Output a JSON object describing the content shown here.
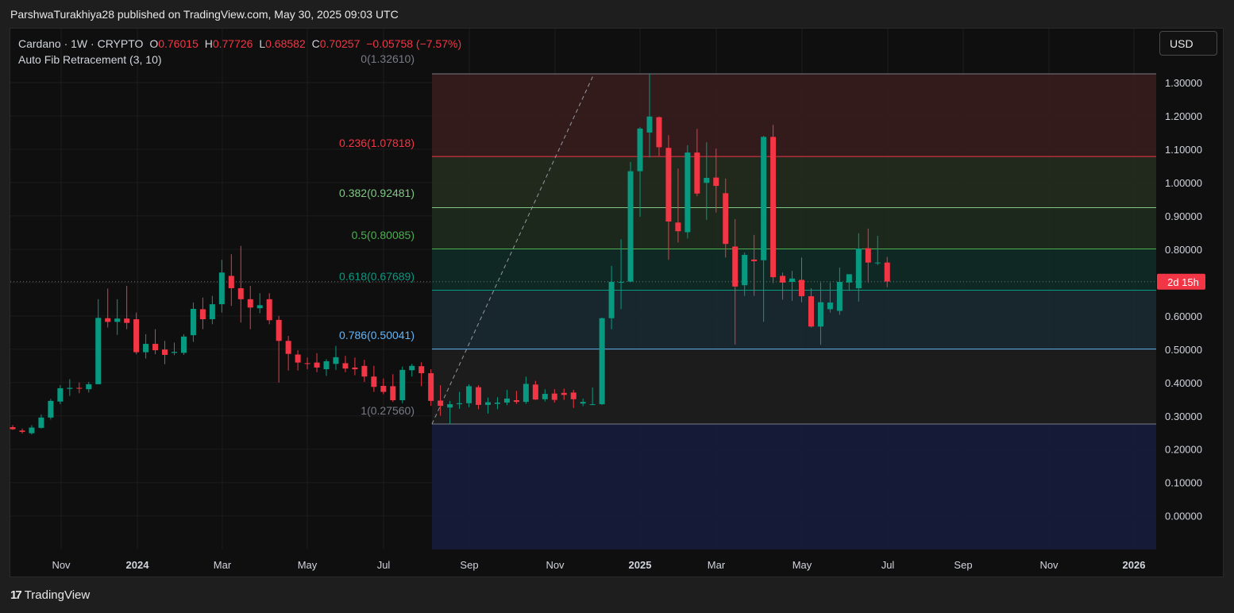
{
  "header": {
    "publish_line": "ParshwaTurakhiya28 published on TradingView.com, May 30, 2025 09:03 UTC"
  },
  "legend": {
    "symbol": "Cardano · 1W · CRYPTO",
    "o_label": "O",
    "o_value": "0.76015",
    "h_label": "H",
    "h_value": "0.77726",
    "l_label": "L",
    "l_value": "0.68582",
    "c_label": "C",
    "c_value": "0.70257",
    "change": "−0.05758 (−7.57%)",
    "indicator": "Auto Fib Retracement (3, 10)"
  },
  "currency_button": "USD",
  "countdown_badge": "2d 15h",
  "footer": {
    "brand": "TradingView",
    "logo_glyph": "17"
  },
  "colors": {
    "up": "#089981",
    "down": "#f23645",
    "background": "#0f0f0f",
    "fib_0": "#787b86",
    "fib_0236": "#f23645",
    "fib_0382": "#81c784",
    "fib_05": "#4caf50",
    "fib_0618": "#089981",
    "fib_0786": "#64b5f6",
    "fib_1": "#787b86"
  },
  "chart_data": {
    "type": "candlestick",
    "title": "Cardano · 1W · CRYPTO",
    "ylim": [
      -0.095,
      1.35
    ],
    "y_ticks": [
      "1.30000",
      "1.20000",
      "1.10000",
      "1.00000",
      "0.90000",
      "0.80000",
      "0.70000",
      "0.60000",
      "0.50000",
      "0.40000",
      "0.30000",
      "0.20000",
      "0.10000",
      "0.00000"
    ],
    "x_ticks": [
      "Nov",
      "2024",
      "Mar",
      "May",
      "Jul",
      "Sep",
      "Nov",
      "2025",
      "Mar",
      "May",
      "Jul",
      "Sep",
      "Nov",
      "2026"
    ],
    "grid": true,
    "last_price": 0.70257,
    "fib_levels": [
      {
        "ratio": "0",
        "price": 1.3261,
        "label": "0(1.32610)"
      },
      {
        "ratio": "0.236",
        "price": 1.07818,
        "label": "0.236(1.07818)"
      },
      {
        "ratio": "0.382",
        "price": 0.92481,
        "label": "0.382(0.92481)"
      },
      {
        "ratio": "0.5",
        "price": 0.80085,
        "label": "0.5(0.80085)"
      },
      {
        "ratio": "0.618",
        "price": 0.67689,
        "label": "0.618(0.67689)"
      },
      {
        "ratio": "0.786",
        "price": 0.50041,
        "label": "0.786(0.50041)"
      },
      {
        "ratio": "1",
        "price": 0.2756,
        "label": "1(0.27560)"
      }
    ],
    "candles": [
      {
        "o": 0.266,
        "h": 0.272,
        "l": 0.258,
        "c": 0.26
      },
      {
        "o": 0.256,
        "h": 0.262,
        "l": 0.247,
        "c": 0.252
      },
      {
        "o": 0.248,
        "h": 0.272,
        "l": 0.244,
        "c": 0.265
      },
      {
        "o": 0.264,
        "h": 0.304,
        "l": 0.262,
        "c": 0.295
      },
      {
        "o": 0.295,
        "h": 0.351,
        "l": 0.289,
        "c": 0.345
      },
      {
        "o": 0.343,
        "h": 0.392,
        "l": 0.335,
        "c": 0.383
      },
      {
        "o": 0.381,
        "h": 0.41,
        "l": 0.36,
        "c": 0.384
      },
      {
        "o": 0.384,
        "h": 0.4,
        "l": 0.368,
        "c": 0.382
      },
      {
        "o": 0.38,
        "h": 0.402,
        "l": 0.37,
        "c": 0.395
      },
      {
        "o": 0.395,
        "h": 0.65,
        "l": 0.395,
        "c": 0.594
      },
      {
        "o": 0.593,
        "h": 0.682,
        "l": 0.565,
        "c": 0.582
      },
      {
        "o": 0.582,
        "h": 0.65,
        "l": 0.543,
        "c": 0.592
      },
      {
        "o": 0.592,
        "h": 0.69,
        "l": 0.56,
        "c": 0.579
      },
      {
        "o": 0.59,
        "h": 0.61,
        "l": 0.485,
        "c": 0.491
      },
      {
        "o": 0.491,
        "h": 0.545,
        "l": 0.472,
        "c": 0.516
      },
      {
        "o": 0.516,
        "h": 0.56,
        "l": 0.485,
        "c": 0.497
      },
      {
        "o": 0.499,
        "h": 0.525,
        "l": 0.455,
        "c": 0.483
      },
      {
        "o": 0.489,
        "h": 0.52,
        "l": 0.482,
        "c": 0.492
      },
      {
        "o": 0.489,
        "h": 0.545,
        "l": 0.483,
        "c": 0.538
      },
      {
        "o": 0.542,
        "h": 0.64,
        "l": 0.522,
        "c": 0.621
      },
      {
        "o": 0.62,
        "h": 0.655,
        "l": 0.56,
        "c": 0.59
      },
      {
        "o": 0.59,
        "h": 0.66,
        "l": 0.575,
        "c": 0.635
      },
      {
        "o": 0.635,
        "h": 0.768,
        "l": 0.61,
        "c": 0.73
      },
      {
        "o": 0.72,
        "h": 0.785,
        "l": 0.63,
        "c": 0.683
      },
      {
        "o": 0.683,
        "h": 0.81,
        "l": 0.58,
        "c": 0.65
      },
      {
        "o": 0.65,
        "h": 0.69,
        "l": 0.56,
        "c": 0.625
      },
      {
        "o": 0.623,
        "h": 0.668,
        "l": 0.608,
        "c": 0.632
      },
      {
        "o": 0.65,
        "h": 0.668,
        "l": 0.575,
        "c": 0.587
      },
      {
        "o": 0.588,
        "h": 0.6,
        "l": 0.4,
        "c": 0.525
      },
      {
        "o": 0.525,
        "h": 0.54,
        "l": 0.436,
        "c": 0.486
      },
      {
        "o": 0.484,
        "h": 0.497,
        "l": 0.436,
        "c": 0.46
      },
      {
        "o": 0.458,
        "h": 0.475,
        "l": 0.44,
        "c": 0.456
      },
      {
        "o": 0.46,
        "h": 0.488,
        "l": 0.431,
        "c": 0.445
      },
      {
        "o": 0.44,
        "h": 0.47,
        "l": 0.42,
        "c": 0.464
      },
      {
        "o": 0.456,
        "h": 0.51,
        "l": 0.438,
        "c": 0.476
      },
      {
        "o": 0.458,
        "h": 0.48,
        "l": 0.431,
        "c": 0.442
      },
      {
        "o": 0.445,
        "h": 0.475,
        "l": 0.422,
        "c": 0.44
      },
      {
        "o": 0.45,
        "h": 0.468,
        "l": 0.402,
        "c": 0.418
      },
      {
        "o": 0.418,
        "h": 0.45,
        "l": 0.372,
        "c": 0.387
      },
      {
        "o": 0.39,
        "h": 0.412,
        "l": 0.365,
        "c": 0.372
      },
      {
        "o": 0.389,
        "h": 0.425,
        "l": 0.342,
        "c": 0.347
      },
      {
        "o": 0.347,
        "h": 0.448,
        "l": 0.338,
        "c": 0.438
      },
      {
        "o": 0.437,
        "h": 0.456,
        "l": 0.418,
        "c": 0.45
      },
      {
        "o": 0.449,
        "h": 0.461,
        "l": 0.389,
        "c": 0.428
      },
      {
        "o": 0.428,
        "h": 0.44,
        "l": 0.33,
        "c": 0.345
      },
      {
        "o": 0.346,
        "h": 0.392,
        "l": 0.3,
        "c": 0.33
      },
      {
        "o": 0.325,
        "h": 0.345,
        "l": 0.276,
        "c": 0.335
      },
      {
        "o": 0.335,
        "h": 0.372,
        "l": 0.321,
        "c": 0.338
      },
      {
        "o": 0.338,
        "h": 0.395,
        "l": 0.326,
        "c": 0.389
      },
      {
        "o": 0.386,
        "h": 0.392,
        "l": 0.32,
        "c": 0.333
      },
      {
        "o": 0.333,
        "h": 0.355,
        "l": 0.307,
        "c": 0.341
      },
      {
        "o": 0.336,
        "h": 0.356,
        "l": 0.32,
        "c": 0.34
      },
      {
        "o": 0.34,
        "h": 0.378,
        "l": 0.332,
        "c": 0.352
      },
      {
        "o": 0.347,
        "h": 0.375,
        "l": 0.336,
        "c": 0.342
      },
      {
        "o": 0.342,
        "h": 0.418,
        "l": 0.336,
        "c": 0.396
      },
      {
        "o": 0.394,
        "h": 0.405,
        "l": 0.348,
        "c": 0.349
      },
      {
        "o": 0.35,
        "h": 0.38,
        "l": 0.343,
        "c": 0.366
      },
      {
        "o": 0.367,
        "h": 0.38,
        "l": 0.34,
        "c": 0.348
      },
      {
        "o": 0.369,
        "h": 0.382,
        "l": 0.348,
        "c": 0.363
      },
      {
        "o": 0.37,
        "h": 0.378,
        "l": 0.324,
        "c": 0.35
      },
      {
        "o": 0.337,
        "h": 0.352,
        "l": 0.329,
        "c": 0.342
      },
      {
        "o": 0.334,
        "h": 0.385,
        "l": 0.332,
        "c": 0.335
      },
      {
        "o": 0.335,
        "h": 0.595,
        "l": 0.333,
        "c": 0.593
      },
      {
        "o": 0.593,
        "h": 0.75,
        "l": 0.56,
        "c": 0.702
      },
      {
        "o": 0.701,
        "h": 0.83,
        "l": 0.62,
        "c": 0.702
      },
      {
        "o": 0.703,
        "h": 1.062,
        "l": 0.701,
        "c": 1.034
      },
      {
        "o": 1.034,
        "h": 1.166,
        "l": 0.897,
        "c": 1.162
      },
      {
        "o": 1.15,
        "h": 1.326,
        "l": 1.075,
        "c": 1.198
      },
      {
        "o": 1.196,
        "h": 1.198,
        "l": 1.08,
        "c": 1.106
      },
      {
        "o": 1.104,
        "h": 1.142,
        "l": 0.768,
        "c": 0.883
      },
      {
        "o": 0.88,
        "h": 1.042,
        "l": 0.82,
        "c": 0.854
      },
      {
        "o": 0.851,
        "h": 1.112,
        "l": 0.832,
        "c": 1.09
      },
      {
        "o": 1.09,
        "h": 1.161,
        "l": 0.959,
        "c": 0.967
      },
      {
        "o": 0.999,
        "h": 1.121,
        "l": 0.888,
        "c": 1.014
      },
      {
        "o": 1.015,
        "h": 1.102,
        "l": 0.91,
        "c": 0.99
      },
      {
        "o": 0.968,
        "h": 1.012,
        "l": 0.775,
        "c": 0.816
      },
      {
        "o": 0.808,
        "h": 0.89,
        "l": 0.514,
        "c": 0.688
      },
      {
        "o": 0.692,
        "h": 0.79,
        "l": 0.66,
        "c": 0.783
      },
      {
        "o": 0.769,
        "h": 0.843,
        "l": 0.66,
        "c": 0.764
      },
      {
        "o": 0.767,
        "h": 1.14,
        "l": 0.582,
        "c": 1.137
      },
      {
        "o": 1.137,
        "h": 1.173,
        "l": 0.698,
        "c": 0.716
      },
      {
        "o": 0.72,
        "h": 0.73,
        "l": 0.649,
        "c": 0.7
      },
      {
        "o": 0.702,
        "h": 0.735,
        "l": 0.645,
        "c": 0.712
      },
      {
        "o": 0.708,
        "h": 0.775,
        "l": 0.641,
        "c": 0.659
      },
      {
        "o": 0.659,
        "h": 0.683,
        "l": 0.565,
        "c": 0.568
      },
      {
        "o": 0.568,
        "h": 0.7,
        "l": 0.513,
        "c": 0.641
      },
      {
        "o": 0.62,
        "h": 0.7,
        "l": 0.61,
        "c": 0.64
      },
      {
        "o": 0.615,
        "h": 0.745,
        "l": 0.603,
        "c": 0.702
      },
      {
        "o": 0.7,
        "h": 0.722,
        "l": 0.675,
        "c": 0.725
      },
      {
        "o": 0.683,
        "h": 0.848,
        "l": 0.643,
        "c": 0.802
      },
      {
        "o": 0.803,
        "h": 0.862,
        "l": 0.7,
        "c": 0.76
      },
      {
        "o": 0.76,
        "h": 0.84,
        "l": 0.752,
        "c": 0.76
      },
      {
        "o": 0.76,
        "h": 0.777,
        "l": 0.686,
        "c": 0.703
      }
    ]
  }
}
